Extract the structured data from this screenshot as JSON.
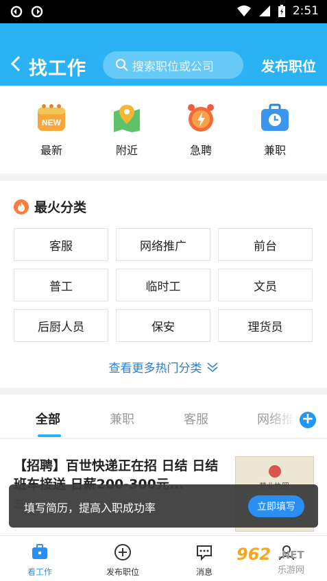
{
  "status_bar": {
    "time": "2:51"
  },
  "header": {
    "title": "找工作",
    "search_placeholder": "搜索职位或公司",
    "publish_label": "发布职位"
  },
  "quick_links": [
    {
      "label": "最新",
      "icon": "new-badge-icon"
    },
    {
      "label": "附近",
      "icon": "map-pin-icon"
    },
    {
      "label": "急聘",
      "icon": "alarm-clock-icon"
    },
    {
      "label": "兼职",
      "icon": "briefcase-clock-icon"
    }
  ],
  "hot_categories": {
    "title": "最火分类",
    "items": [
      "客服",
      "网络推广",
      "前台",
      "普工",
      "临时工",
      "文员",
      "后厨人员",
      "保安",
      "理货员"
    ],
    "more_label": "查看更多热门分类"
  },
  "tabs": {
    "items": [
      "全部",
      "兼职",
      "客服",
      "网络推"
    ],
    "active": "全部"
  },
  "job": {
    "title": "【招聘】百世快递正在招 日结 日结 班车接送 日薪200-300元...",
    "subtitle": "宏",
    "thumb_text": "营业执照"
  },
  "toast": {
    "text": "填写简历，提高入职成功率",
    "button": "立即填写"
  },
  "bottom_nav": [
    {
      "label": "看工作",
      "icon": "briefcase-icon",
      "active": true
    },
    {
      "label": "发布职位",
      "icon": "plus-circle-icon",
      "active": false
    },
    {
      "label": "消息",
      "icon": "chat-bubble-icon",
      "active": false
    },
    {
      "label": "",
      "icon": "user-icon",
      "active": false
    }
  ],
  "watermark": {
    "num": "962",
    "net": ".NET",
    "cn": "乐游网"
  },
  "colors": {
    "brand": "#2ab2f4",
    "accent": "#2a8ff5",
    "link": "#2f80d1"
  }
}
